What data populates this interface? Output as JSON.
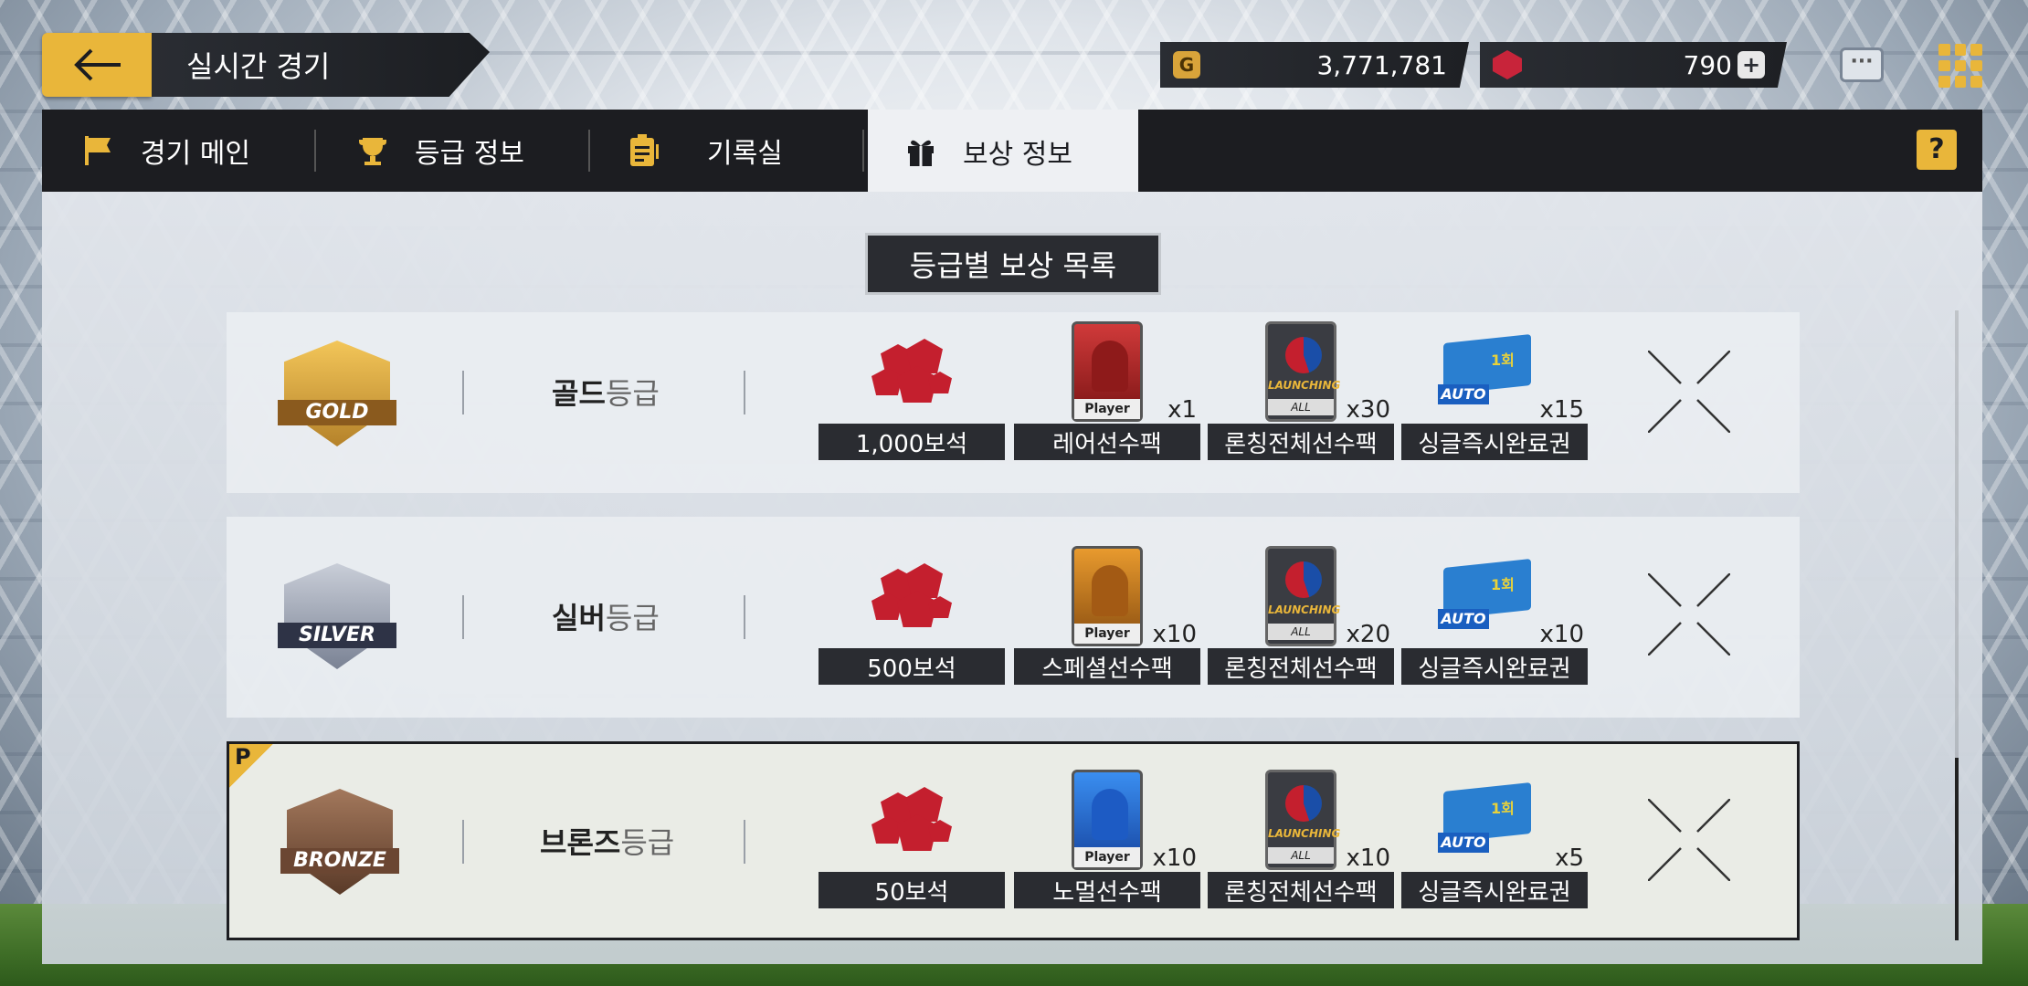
{
  "header": {
    "title": "실시간 경기",
    "gold_amount": "3,771,781",
    "gem_amount": "790",
    "gold_icon_letter": "G"
  },
  "tabs": [
    {
      "label": "경기 메인",
      "icon": "flag-icon"
    },
    {
      "label": "등급 정보",
      "icon": "trophy-icon"
    },
    {
      "label": "기록실",
      "icon": "clipboard-icon"
    },
    {
      "label": "보상 정보",
      "icon": "gift-icon",
      "active": true
    }
  ],
  "help_label": "?",
  "section_title": "등급별 보상 목록",
  "grades": [
    {
      "emblem_text": "GOLD",
      "name": "골드",
      "suffix": "등급",
      "rewards": [
        {
          "label": "1,000보석",
          "qty": "",
          "type": "gems"
        },
        {
          "label": "레어선수팩",
          "qty": "x1",
          "type": "card",
          "card_badge": "Player"
        },
        {
          "label": "론칭전체선수팩",
          "qty": "x30",
          "type": "launch",
          "pack_text1": "LAUNCHING",
          "pack_text2": "ALL"
        },
        {
          "label": "싱글즉시완료권",
          "qty": "x15",
          "type": "ticket",
          "ticket_text": "1회",
          "auto_text": "AUTO"
        }
      ]
    },
    {
      "emblem_text": "SILVER",
      "name": "실버",
      "suffix": "등급",
      "rewards": [
        {
          "label": "500보석",
          "qty": "",
          "type": "gems"
        },
        {
          "label": "스페셜선수팩",
          "qty": "x10",
          "type": "card",
          "card_badge": "Player"
        },
        {
          "label": "론칭전체선수팩",
          "qty": "x20",
          "type": "launch",
          "pack_text1": "LAUNCHING",
          "pack_text2": "ALL"
        },
        {
          "label": "싱글즉시완료권",
          "qty": "x10",
          "type": "ticket",
          "ticket_text": "1회",
          "auto_text": "AUTO"
        }
      ]
    },
    {
      "emblem_text": "BRONZE",
      "name": "브론즈",
      "suffix": "등급",
      "current_badge": "P",
      "rewards": [
        {
          "label": "50보석",
          "qty": "",
          "type": "gems"
        },
        {
          "label": "노멀선수팩",
          "qty": "x10",
          "type": "card",
          "card_badge": "Player"
        },
        {
          "label": "론칭전체선수팩",
          "qty": "x10",
          "type": "launch",
          "pack_text1": "LAUNCHING",
          "pack_text2": "ALL"
        },
        {
          "label": "싱글즉시완료권",
          "qty": "x5",
          "type": "ticket",
          "ticket_text": "1회",
          "auto_text": "AUTO"
        }
      ]
    }
  ],
  "colors": {
    "accent": "#e9b63a",
    "dark": "#1c1d21",
    "gem": "#c41f2e"
  }
}
